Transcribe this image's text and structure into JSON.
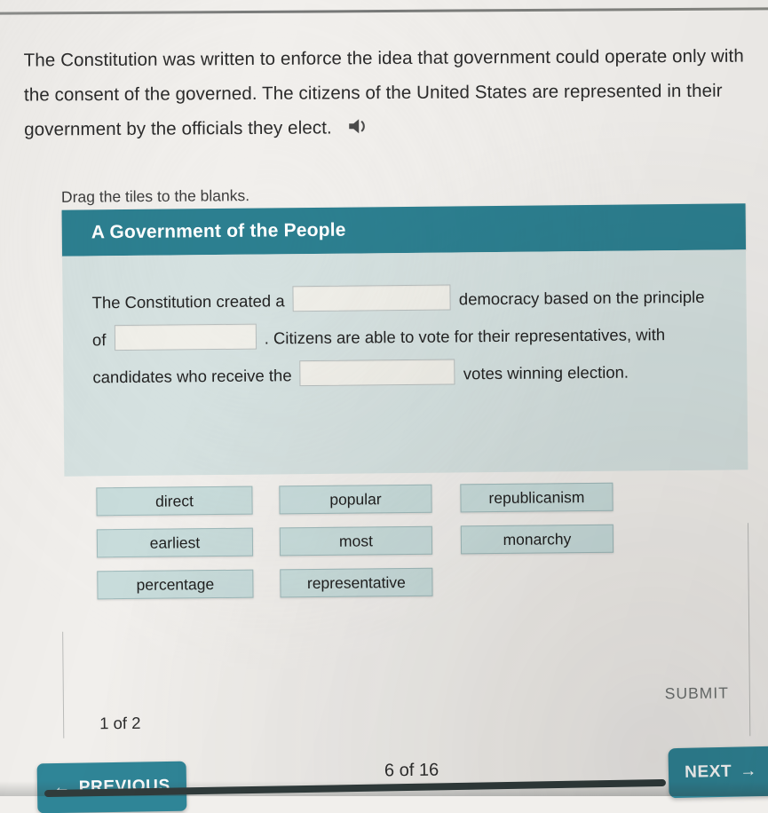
{
  "passage": {
    "text": "The Constitution was written to enforce the idea that government could operate only with the consent of the governed. The citizens of the United States are represented in their government by the officials they elect.",
    "audio_icon": "speaker-icon"
  },
  "instruction": "Drag the tiles to the blanks.",
  "activity": {
    "title": "A Government of the People",
    "cloze": {
      "seg1": "The Constitution created a",
      "seg2": "democracy based on the principle of",
      "seg3": ". Citizens are able to vote for their representatives, with candidates who receive the",
      "seg4": "votes winning election."
    },
    "blanks": [
      "",
      "",
      ""
    ],
    "tiles": [
      [
        "direct",
        "popular",
        "republicanism"
      ],
      [
        "earliest",
        "most",
        "monarchy"
      ],
      [
        "percentage",
        "representative"
      ]
    ]
  },
  "footer": {
    "page_counter": "1 of 2",
    "submit_label": "SUBMIT"
  },
  "nav": {
    "previous_label": "PREVIOUS",
    "next_label": "NEXT",
    "question_counter": "6 of 16",
    "back_arrow": "←",
    "forward_arrow": "→"
  },
  "colors": {
    "teal_header": "#2c7f90",
    "teal_button": "#2f8597",
    "panel": "#d5e1e0",
    "tile": "#c8dcdb",
    "page_bg": "#f1efec"
  }
}
